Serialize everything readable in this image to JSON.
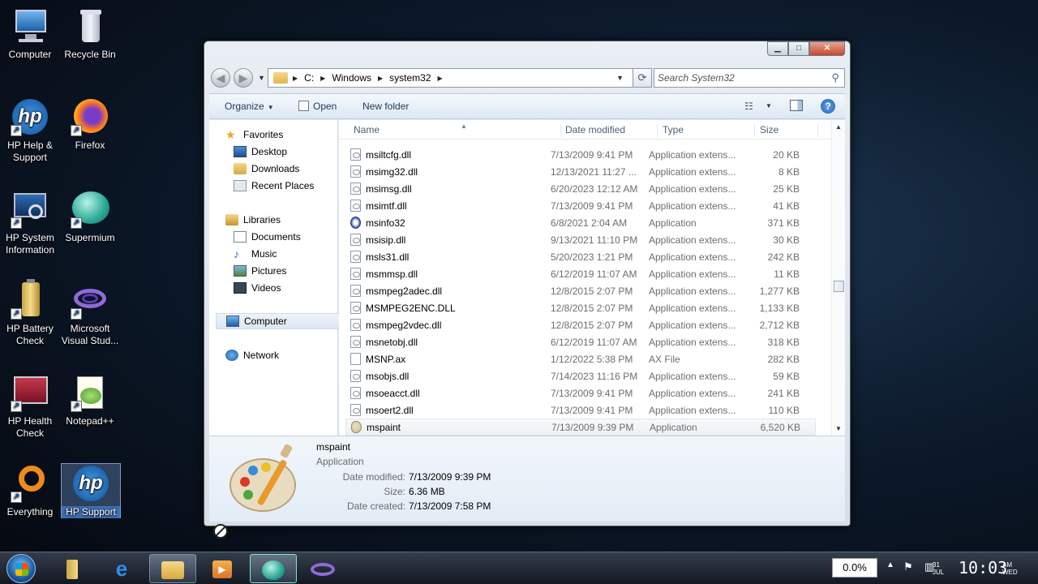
{
  "desktop": {
    "icons": [
      {
        "label": "Computer"
      },
      {
        "label": "Recycle Bin"
      },
      {
        "label": "HP Help & Support"
      },
      {
        "label": "Firefox"
      },
      {
        "label": "HP System Information"
      },
      {
        "label": "Supermium"
      },
      {
        "label": "HP Battery Check"
      },
      {
        "label": "Microsoft Visual Stud..."
      },
      {
        "label": "HP Health Check"
      },
      {
        "label": "Notepad++"
      },
      {
        "label": "Everything"
      },
      {
        "label": "HP Support"
      }
    ]
  },
  "window": {
    "caption": {
      "minimize": "▁",
      "maximize": "□",
      "close": "✕"
    },
    "address": {
      "crumbs": [
        "C:",
        "Windows",
        "system32"
      ],
      "search_placeholder": "Search System32"
    },
    "toolbar": {
      "organize": "Organize",
      "open": "Open",
      "new_folder": "New folder"
    },
    "navpane": {
      "favorites": "Favorites",
      "desktop": "Desktop",
      "downloads": "Downloads",
      "recent": "Recent Places",
      "libraries": "Libraries",
      "documents": "Documents",
      "music": "Music",
      "pictures": "Pictures",
      "videos": "Videos",
      "computer": "Computer",
      "network": "Network"
    },
    "columns": {
      "name": "Name",
      "date": "Date modified",
      "type": "Type",
      "size": "Size"
    },
    "files": [
      {
        "name": "msiltcfg.dll",
        "date": "7/13/2009 9:41 PM",
        "type": "Application extens...",
        "size": "20 KB",
        "icon": "dll"
      },
      {
        "name": "msimg32.dll",
        "date": "12/13/2021 11:27 ...",
        "type": "Application extens...",
        "size": "8 KB",
        "icon": "dll"
      },
      {
        "name": "msimsg.dll",
        "date": "6/20/2023 12:12 AM",
        "type": "Application extens...",
        "size": "25 KB",
        "icon": "dll"
      },
      {
        "name": "msimtf.dll",
        "date": "7/13/2009 9:41 PM",
        "type": "Application extens...",
        "size": "41 KB",
        "icon": "dll"
      },
      {
        "name": "msinfo32",
        "date": "6/8/2021 2:04 AM",
        "type": "Application",
        "size": "371 KB",
        "icon": "app"
      },
      {
        "name": "msisip.dll",
        "date": "9/13/2021 11:10 PM",
        "type": "Application extens...",
        "size": "30 KB",
        "icon": "dll"
      },
      {
        "name": "msls31.dll",
        "date": "5/20/2023 1:21 PM",
        "type": "Application extens...",
        "size": "242 KB",
        "icon": "dll"
      },
      {
        "name": "msmmsp.dll",
        "date": "6/12/2019 11:07 AM",
        "type": "Application extens...",
        "size": "11 KB",
        "icon": "dll"
      },
      {
        "name": "msmpeg2adec.dll",
        "date": "12/8/2015 2:07 PM",
        "type": "Application extens...",
        "size": "1,277 KB",
        "icon": "dll"
      },
      {
        "name": "MSMPEG2ENC.DLL",
        "date": "12/8/2015 2:07 PM",
        "type": "Application extens...",
        "size": "1,133 KB",
        "icon": "dll"
      },
      {
        "name": "msmpeg2vdec.dll",
        "date": "12/8/2015 2:07 PM",
        "type": "Application extens...",
        "size": "2,712 KB",
        "icon": "dll"
      },
      {
        "name": "msnetobj.dll",
        "date": "6/12/2019 11:07 AM",
        "type": "Application extens...",
        "size": "318 KB",
        "icon": "dll"
      },
      {
        "name": "MSNP.ax",
        "date": "1/12/2022 5:38 PM",
        "type": "AX File",
        "size": "282 KB",
        "icon": "ax"
      },
      {
        "name": "msobjs.dll",
        "date": "7/14/2023 11:16 PM",
        "type": "Application extens...",
        "size": "59 KB",
        "icon": "dll"
      },
      {
        "name": "msoeacct.dll",
        "date": "7/13/2009 9:41 PM",
        "type": "Application extens...",
        "size": "241 KB",
        "icon": "dll"
      },
      {
        "name": "msoert2.dll",
        "date": "7/13/2009 9:41 PM",
        "type": "Application extens...",
        "size": "110 KB",
        "icon": "dll"
      },
      {
        "name": "mspaint",
        "date": "7/13/2009 9:39 PM",
        "type": "Application",
        "size": "6,520 KB",
        "icon": "paint",
        "selected": true
      }
    ],
    "details": {
      "name": "mspaint",
      "type": "Application",
      "date_modified_label": "Date modified:",
      "date_modified": "7/13/2009 9:39 PM",
      "size_label": "Size:",
      "size": "6.36 MB",
      "date_created_label": "Date created:",
      "date_created": "7/13/2009 7:58 PM"
    }
  },
  "taskbar": {
    "cpu": "0.0%",
    "time": "10:03",
    "ampm": "AM",
    "weekday": "WED",
    "day": "31",
    "month": "JUL"
  }
}
